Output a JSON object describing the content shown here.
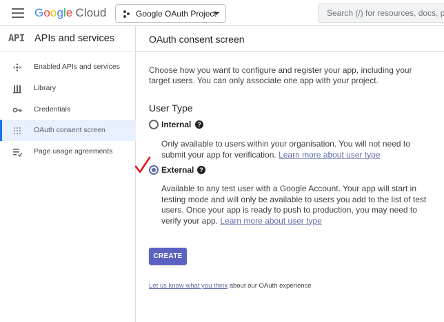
{
  "header": {
    "brand_parts": [
      "G",
      "o",
      "o",
      "g",
      "l",
      "e"
    ],
    "brand_suffix": "Cloud",
    "project_name": "Google OAuth Project",
    "search_placeholder": "Search (/) for resources, docs, products, and more"
  },
  "sidebar": {
    "badge": "API",
    "title": "APIs and services",
    "items": [
      {
        "label": "Enabled APIs and services",
        "icon": "enabled-apis-icon",
        "active": false
      },
      {
        "label": "Library",
        "icon": "library-icon",
        "active": false
      },
      {
        "label": "Credentials",
        "icon": "key-icon",
        "active": false
      },
      {
        "label": "OAuth consent screen",
        "icon": "consent-screen-icon",
        "active": true
      },
      {
        "label": "Page usage agreements",
        "icon": "agreements-icon",
        "active": false
      }
    ]
  },
  "main": {
    "title": "OAuth consent screen",
    "intro": "Choose how you want to configure and register your app, including your target users. You can only associate one app with your project.",
    "user_type_title": "User Type",
    "options": {
      "internal": {
        "label": "Internal",
        "checked": false,
        "description": "Only available to users within your organisation. You will not need to submit your app for verification. ",
        "link": "Learn more about user type"
      },
      "external": {
        "label": "External",
        "checked": true,
        "description": "Available to any test user with a Google Account. Your app will start in testing mode and will only be available to users you add to the list of test users. Once your app is ready to push to production, you may need to verify your app. ",
        "link": "Learn more about user type"
      }
    },
    "create_label": "CREATE",
    "feedback_link": "Let us know what you think",
    "feedback_suffix": " about our OAuth experience"
  },
  "colors": {
    "accent": "#5c62c2",
    "link": "#5f6aa6",
    "annotation_check": "#e0151b"
  }
}
